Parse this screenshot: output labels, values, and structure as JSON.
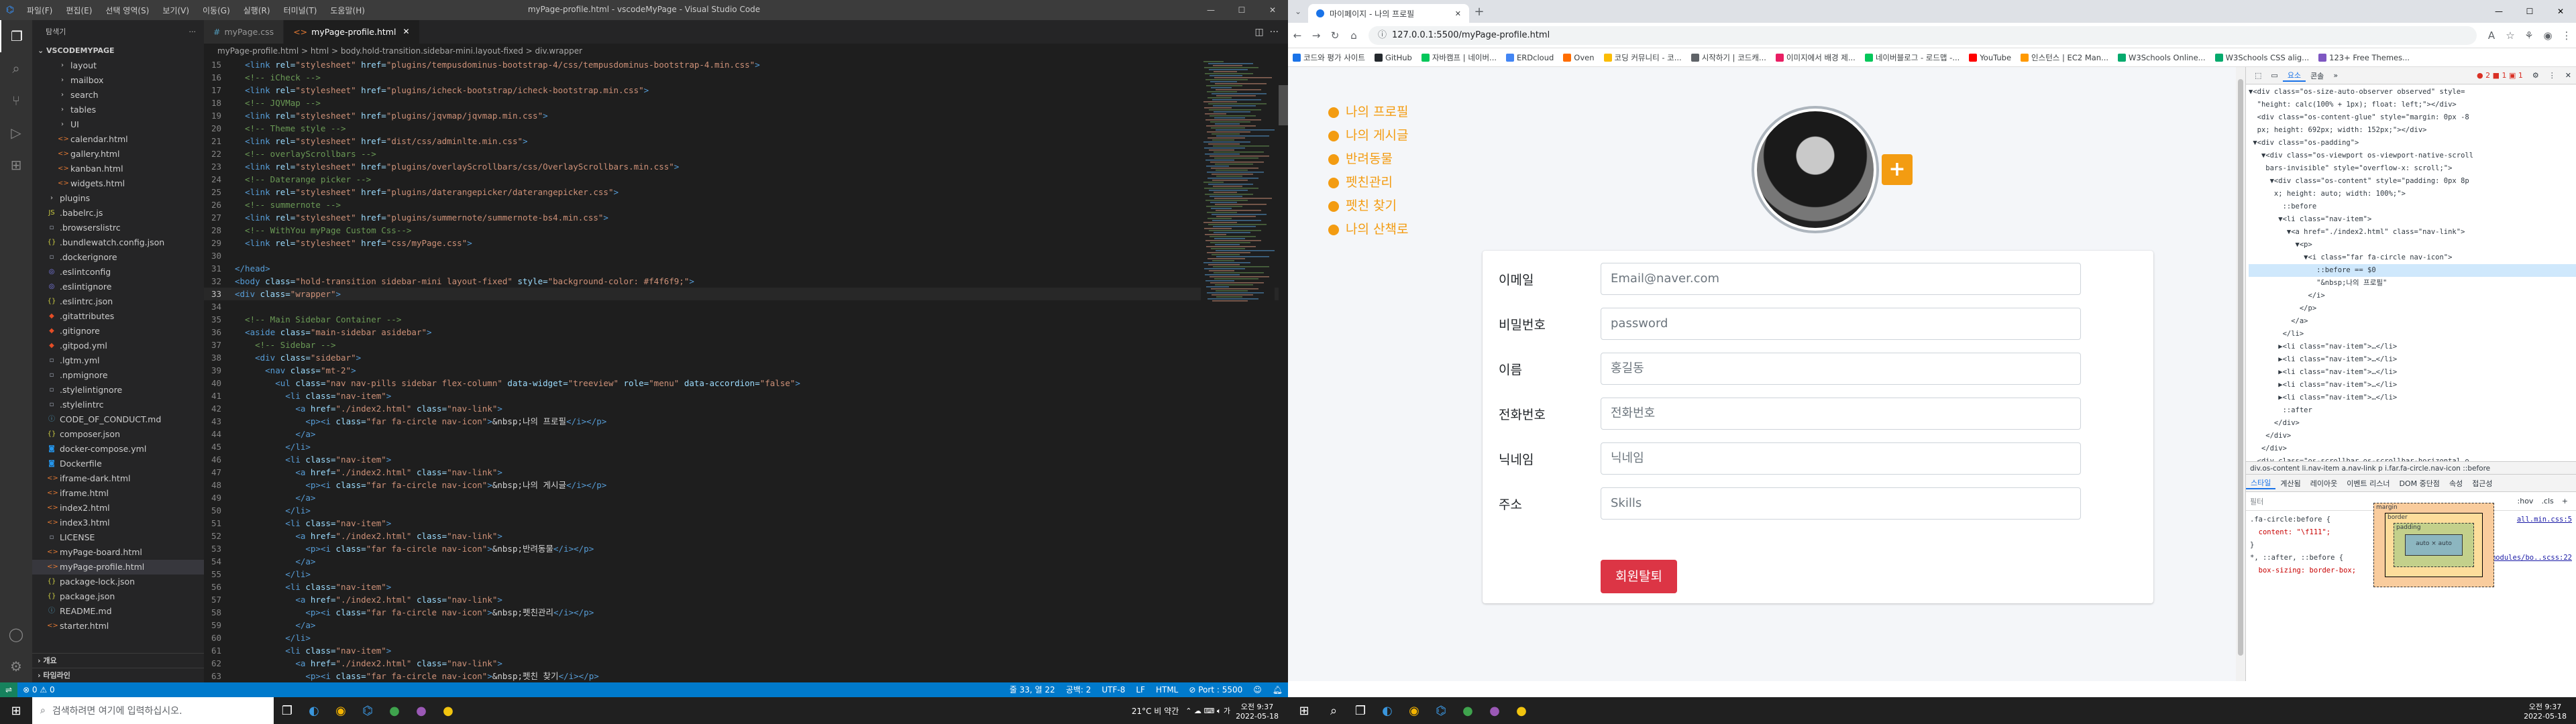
{
  "vscode": {
    "menu": [
      "파일(F)",
      "편집(E)",
      "선택 영역(S)",
      "보기(V)",
      "이동(G)",
      "실행(R)",
      "터미널(T)",
      "도움말(H)"
    ],
    "title": "myPage-profile.html - vscodeMyPage - Visual Studio Code",
    "explorer_title": "탐색기",
    "project_name": "VSCODEMYPAGE",
    "tree": [
      "layout",
      "mailbox",
      "search",
      "tables",
      "UI",
      "calendar.html",
      "gallery.html",
      "kanban.html",
      "widgets.html",
      "plugins",
      ".babelrc.js",
      ".browserslistrc",
      ".bundlewatch.config.json",
      ".dockerignore",
      ".eslintconfig",
      ".eslintignore",
      ".eslintrc.json",
      ".gitattributes",
      ".gitignore",
      ".gitpod.yml",
      ".lgtm.yml",
      ".npmignore",
      ".stylelintignore",
      ".stylelintrc",
      "CODE_OF_CONDUCT.md",
      "composer.json",
      "docker-compose.yml",
      "Dockerfile",
      "iframe-dark.html",
      "iframe.html",
      "index2.html",
      "index3.html",
      "LICENSE",
      "myPage-board.html",
      "myPage-profile.html",
      "package-lock.json",
      "package.json",
      "README.md",
      "starter.html"
    ],
    "outline_label": "개요",
    "timeline_label": "타임라인",
    "tabs": [
      "myPage.css",
      "myPage-profile.html"
    ],
    "breadcrumb": "myPage-profile.html > html > body.hold-transition.sidebar-mini.layout-fixed > div.wrapper",
    "code_lines": [
      {
        "n": "15",
        "t": "  <link rel=\"stylesheet\" href=\"plugins/tempusdominus-bootstrap-4/css/tempusdominus-bootstrap-4.min.css\">"
      },
      {
        "n": "16",
        "t": "  <!-- iCheck -->"
      },
      {
        "n": "17",
        "t": "  <link rel=\"stylesheet\" href=\"plugins/icheck-bootstrap/icheck-bootstrap.min.css\">"
      },
      {
        "n": "18",
        "t": "  <!-- JQVMap -->"
      },
      {
        "n": "19",
        "t": "  <link rel=\"stylesheet\" href=\"plugins/jqvmap/jqvmap.min.css\">"
      },
      {
        "n": "20",
        "t": "  <!-- Theme style -->"
      },
      {
        "n": "21",
        "t": "  <link rel=\"stylesheet\" href=\"dist/css/adminlte.min.css\">"
      },
      {
        "n": "22",
        "t": "  <!-- overlayScrollbars -->"
      },
      {
        "n": "23",
        "t": "  <link rel=\"stylesheet\" href=\"plugins/overlayScrollbars/css/OverlayScrollbars.min.css\">"
      },
      {
        "n": "24",
        "t": "  <!-- Daterange picker -->"
      },
      {
        "n": "25",
        "t": "  <link rel=\"stylesheet\" href=\"plugins/daterangepicker/daterangepicker.css\">"
      },
      {
        "n": "26",
        "t": "  <!-- summernote -->"
      },
      {
        "n": "27",
        "t": "  <link rel=\"stylesheet\" href=\"plugins/summernote/summernote-bs4.min.css\">"
      },
      {
        "n": "28",
        "t": "  <!-- WithYou myPage Custom Css-->"
      },
      {
        "n": "29",
        "t": "  <link rel=\"stylesheet\" href=\"css/myPage.css\">"
      },
      {
        "n": "30",
        "t": ""
      },
      {
        "n": "31",
        "t": "</head>"
      },
      {
        "n": "32",
        "t": "<body class=\"hold-transition sidebar-mini layout-fixed\" style=\"background-color: #f4f6f9;\">"
      },
      {
        "n": "33",
        "t": "<div class=\"wrapper\">"
      },
      {
        "n": "34",
        "t": ""
      },
      {
        "n": "35",
        "t": "  <!-- Main Sidebar Container -->"
      },
      {
        "n": "36",
        "t": "  <aside class=\"main-sidebar asidebar\">"
      },
      {
        "n": "37",
        "t": "    <!-- Sidebar -->"
      },
      {
        "n": "38",
        "t": "    <div class=\"sidebar\">"
      },
      {
        "n": "39",
        "t": "      <nav class=\"mt-2\">"
      },
      {
        "n": "40",
        "t": "        <ul class=\"nav nav-pills sidebar flex-column\" data-widget=\"treeview\" role=\"menu\" data-accordion=\"false\">"
      },
      {
        "n": "41",
        "t": "          <li class=\"nav-item\">"
      },
      {
        "n": "42",
        "t": "            <a href=\"./index2.html\" class=\"nav-link\">"
      },
      {
        "n": "43",
        "t": "              <p><i class=\"far fa-circle nav-icon\">&nbsp;나의 프로필</i></p>"
      },
      {
        "n": "44",
        "t": "            </a>"
      },
      {
        "n": "45",
        "t": "          </li>"
      },
      {
        "n": "46",
        "t": "          <li class=\"nav-item\">"
      },
      {
        "n": "47",
        "t": "            <a href=\"./index2.html\" class=\"nav-link\">"
      },
      {
        "n": "48",
        "t": "              <p><i class=\"far fa-circle nav-icon\">&nbsp;나의 게시글</i></p>"
      },
      {
        "n": "49",
        "t": "            </a>"
      },
      {
        "n": "50",
        "t": "          </li>"
      },
      {
        "n": "51",
        "t": "          <li class=\"nav-item\">"
      },
      {
        "n": "52",
        "t": "            <a href=\"./index2.html\" class=\"nav-link\">"
      },
      {
        "n": "53",
        "t": "              <p><i class=\"far fa-circle nav-icon\">&nbsp;반려동물</i></p>"
      },
      {
        "n": "54",
        "t": "            </a>"
      },
      {
        "n": "55",
        "t": "          </li>"
      },
      {
        "n": "56",
        "t": "          <li class=\"nav-item\">"
      },
      {
        "n": "57",
        "t": "            <a href=\"./index2.html\" class=\"nav-link\">"
      },
      {
        "n": "58",
        "t": "              <p><i class=\"far fa-circle nav-icon\">&nbsp;펫친관리</i></p>"
      },
      {
        "n": "59",
        "t": "            </a>"
      },
      {
        "n": "60",
        "t": "          </li>"
      },
      {
        "n": "61",
        "t": "          <li class=\"nav-item\">"
      },
      {
        "n": "62",
        "t": "            <a href=\"./index2.html\" class=\"nav-link\">"
      },
      {
        "n": "63",
        "t": "              <p><i class=\"far fa-circle nav-icon\">&nbsp;펫친 찾기</i></p>"
      }
    ],
    "current_line": "33",
    "status": {
      "errors": "⊗ 0 ⚠ 0",
      "position": "줄 33, 열 22",
      "spaces": "공백: 2",
      "encoding": "UTF-8",
      "eol": "LF",
      "language": "HTML",
      "port": "⊘ Port : 5500"
    }
  },
  "chrome": {
    "tab_title": "마이페이지 - 나의 프로필",
    "url": "127.0.0.1:5500/myPage-profile.html",
    "bookmarks": [
      "코드와 평가 사이트",
      "GitHub",
      "자바캠프 | 네이버...",
      "ERDcloud",
      "Oven",
      "코딩 커뮤니티 - 코...",
      "시작하기 | 코드캐...",
      "이미지에서 배경 제...",
      "네이버블로그 - 로드맵 -...",
      "YouTube",
      "인스턴스 | EC2 Man...",
      "W3Schools Online...",
      "W3Schools CSS alig...",
      "123+ Free Themes..."
    ]
  },
  "page": {
    "nav": [
      "나의 프로필",
      "나의 게시글",
      "반려동물",
      "펫친관리",
      "펫친 찾기",
      "나의 산책로"
    ],
    "add_button": "+",
    "fields": [
      {
        "label": "이메일",
        "placeholder": "Email@naver.com"
      },
      {
        "label": "비밀번호",
        "placeholder": "password"
      },
      {
        "label": "이름",
        "placeholder": "홍길동"
      },
      {
        "label": "전화번호",
        "placeholder": "전화번호"
      },
      {
        "label": "닉네임",
        "placeholder": "닉네임"
      },
      {
        "label": "주소",
        "placeholder": "Skills"
      }
    ],
    "leave_button": "회원탈퇴"
  },
  "devtools": {
    "tabs": [
      "요소",
      "콘솔"
    ],
    "badges": "● 2  ■ 1  ▣ 1",
    "dom_lines": [
      "▼<div class=\"os-size-auto-observer observed\" style=",
      "  \"height: calc(100% + 1px); float: left;\"></div>",
      "  <div class=\"os-content-glue\" style=\"margin: 0px -8",
      "  px; height: 692px; width: 152px;\"></div>",
      " ▼<div class=\"os-padding\">",
      "   ▼<div class=\"os-viewport os-viewport-native-scroll",
      "    bars-invisible\" style=\"overflow-x: scroll;\">",
      "     ▼<div class=\"os-content\" style=\"padding: 0px 8p",
      "      x; height: auto; width: 100%;\">",
      "        ::before",
      "       ▼<li class=\"nav-item\">",
      "         ▼<a href=\"./index2.html\" class=\"nav-link\">",
      "           ▼<p>",
      "             ▼<i class=\"far fa-circle nav-icon\">",
      "                ::before == $0",
      "                \"&nbsp;나의 프로필\"",
      "              </i>",
      "            </p>",
      "          </a>",
      "        </li>",
      "       ▶<li class=\"nav-item\">…</li>",
      "       ▶<li class=\"nav-item\">…</li>",
      "       ▶<li class=\"nav-item\">…</li>",
      "       ▶<li class=\"nav-item\">…</li>",
      "       ▶<li class=\"nav-item\">…</li>",
      "        ::after",
      "      </div>",
      "    </div>",
      "   </div>",
      "  <div class=\"os-scrollbar os-scrollbar-horizontal o"
    ],
    "path": "div.os-content  li.nav-item  a.nav-link  p  i.far.fa-circle.nav-icon  ::before",
    "style_tabs": [
      "스타일",
      "계산됨",
      "레이아웃",
      "이벤트 리스너",
      "DOM 중단점",
      "속성",
      "접근성"
    ],
    "filter_placeholder": "필터",
    "filter_hov": ":hov",
    "filter_cls": ".cls",
    "rules": [
      {
        "sel": ".fa-circle:before {",
        "src": "all.min.css:5",
        "body": "  content: \"\\f111\";"
      },
      {
        "sel": "}",
        "src": "",
        "body": ""
      },
      {
        "sel": "*, ::after, ::before {",
        "src": "../node_modules/bo..scss:22",
        "body": "  box-sizing: border-box;"
      }
    ],
    "boxmodel": {
      "margin": "margin",
      "border": "border",
      "padding": "padding",
      "content": "auto × auto",
      "dash": "-"
    }
  },
  "taskbar_left": {
    "search_placeholder": "검색하려면 여기에 입력하십시오.",
    "weather": "21°C 비 약간",
    "time": "오전 9:37",
    "date": "2022-05-18"
  },
  "taskbar_right": {
    "time": "오전 9:37",
    "date": "2022-05-18"
  }
}
